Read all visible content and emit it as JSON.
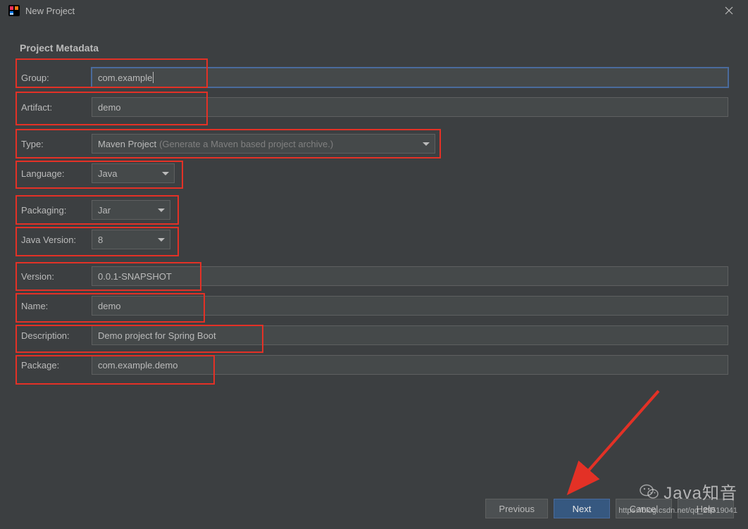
{
  "window": {
    "title": "New Project"
  },
  "section": {
    "title": "Project Metadata"
  },
  "fields": {
    "group": {
      "label": "Group:",
      "value": "com.example"
    },
    "artifact": {
      "label": "Artifact:",
      "value": "demo"
    },
    "type": {
      "label": "Type:",
      "value": "Maven Project",
      "hint": "(Generate a Maven based project archive.)"
    },
    "language": {
      "label": "Language:",
      "value": "Java"
    },
    "packaging": {
      "label": "Packaging:",
      "value": "Jar"
    },
    "javaVersion": {
      "label": "Java Version:",
      "value": "8"
    },
    "version": {
      "label": "Version:",
      "value": "0.0.1-SNAPSHOT"
    },
    "name": {
      "label": "Name:",
      "value": "demo"
    },
    "description": {
      "label": "Description:",
      "value": "Demo project for Spring Boot"
    },
    "package": {
      "label": "Package:",
      "value": "com.example.demo"
    }
  },
  "buttons": {
    "previous": "Previous",
    "next": "Next",
    "cancel": "Cancel",
    "help": "Help"
  },
  "watermark": {
    "title": "Java知音",
    "url": "https://blog.csdn.net/qq_29519041"
  }
}
